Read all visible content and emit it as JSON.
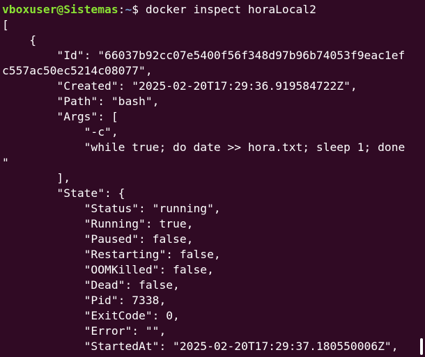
{
  "prompt": {
    "user_host": "vboxuser@Sistemas",
    "separator": ":",
    "path": "~",
    "symbol": "$ ",
    "command": "docker inspect horaLocal2"
  },
  "output_lines": [
    "[",
    "    {",
    "        \"Id\": \"66037b92cc07e5400f56f348d97b96b74053f9eac1ef",
    "c557ac50ec5214c08077\",",
    "        \"Created\": \"2025-02-20T17:29:36.919584722Z\",",
    "        \"Path\": \"bash\",",
    "        \"Args\": [",
    "            \"-c\",",
    "            \"while true; do date >> hora.txt; sleep 1; done",
    "\"",
    "        ],",
    "        \"State\": {",
    "            \"Status\": \"running\",",
    "            \"Running\": true,",
    "            \"Paused\": false,",
    "            \"Restarting\": false,",
    "            \"OOMKilled\": false,",
    "            \"Dead\": false,",
    "            \"Pid\": 7338,",
    "            \"ExitCode\": 0,",
    "            \"Error\": \"\",",
    "            \"StartedAt\": \"2025-02-20T17:29:37.180550006Z\","
  ],
  "colors": {
    "background": "#300a24",
    "text": "#ffffff",
    "prompt_user": "#8ae234",
    "prompt_path": "#729fcf"
  }
}
